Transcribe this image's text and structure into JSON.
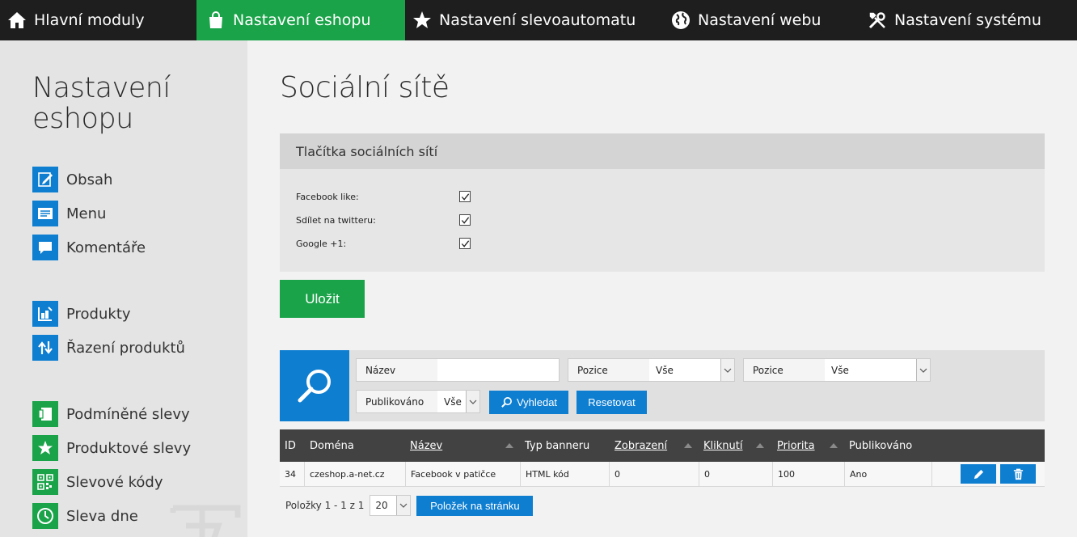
{
  "nav": {
    "tabs": [
      {
        "label": "Hlavní moduly",
        "icon": "home-icon"
      },
      {
        "label": "Nastavení eshopu",
        "icon": "shopping-bag-icon",
        "active": true
      },
      {
        "label": "Nastavení slevoautomatu",
        "icon": "star-icon"
      },
      {
        "label": "Nastavení webu",
        "icon": "globe-icon"
      },
      {
        "label": "Nastavení systému",
        "icon": "tools-icon"
      }
    ]
  },
  "sidebar": {
    "title_line1": "Nastavení",
    "title_line2": "eshopu",
    "items": [
      {
        "label": "Obsah",
        "icon": "edit-icon"
      },
      {
        "label": "Menu",
        "icon": "menu-icon"
      },
      {
        "label": "Komentáře",
        "icon": "comment-icon"
      },
      {
        "label": "Produkty",
        "icon": "products-icon"
      },
      {
        "label": "Řazení produktů",
        "icon": "sort-icon"
      },
      {
        "label": "Podmíněné slevy",
        "icon": "coupon-icon"
      },
      {
        "label": "Produktové slevy",
        "icon": "star-icon"
      },
      {
        "label": "Slevové kódy",
        "icon": "qr-icon"
      },
      {
        "label": "Sleva dne",
        "icon": "clock-icon"
      }
    ]
  },
  "main": {
    "title": "Sociální sítě",
    "panel": {
      "heading": "Tlačítka sociálních sítí",
      "options": [
        {
          "label": "Facebook like:",
          "checked": true
        },
        {
          "label": "Sdílet na twitteru:",
          "checked": true
        },
        {
          "label": "Google +1:",
          "checked": true
        }
      ]
    },
    "save_label": "Uložit",
    "filter": {
      "name_label": "Název",
      "name_value": "",
      "position1_label": "Pozice",
      "position1_value": "Vše",
      "position2_label": "Pozice",
      "position2_value": "Vše",
      "published_label": "Publikováno",
      "published_value": "Vše",
      "search_label": "Vyhledat",
      "reset_label": "Resetovat"
    },
    "table": {
      "columns": [
        "ID",
        "Doména",
        "Název",
        "Typ banneru",
        "Zobrazení",
        "Kliknutí",
        "Priorita",
        "Publikováno"
      ],
      "rows": [
        [
          "34",
          "czeshop.a-net.cz",
          "Facebook v patičce",
          "HTML kód",
          "0",
          "0",
          "100",
          "Ano"
        ]
      ]
    },
    "pager": {
      "info": "Položky 1 - 1 z 1",
      "per_page": "20",
      "per_page_button": "Položek na stránku"
    }
  },
  "colors": {
    "nav_bg": "#1e1e1e",
    "accent_green": "#1aa349",
    "accent_blue": "#0e7ed1",
    "table_head": "#424242"
  }
}
